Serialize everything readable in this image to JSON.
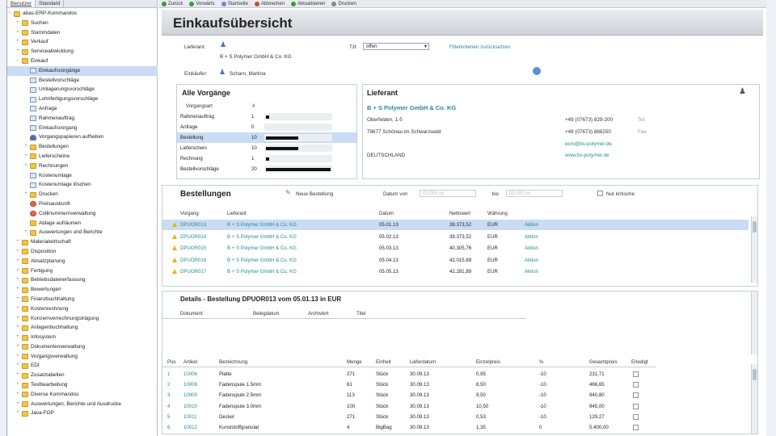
{
  "sidebar": {
    "tabs": [
      "Benutzer",
      "Standard"
    ],
    "tree": [
      {
        "label": "abas-ERP-Kommandos",
        "lvl": 0,
        "exp": "−",
        "icon": "folder"
      },
      {
        "label": "Suchen",
        "lvl": 1,
        "exp": "+",
        "icon": "folder"
      },
      {
        "label": "Stammdaten",
        "lvl": 1,
        "exp": "+",
        "icon": "folder"
      },
      {
        "label": "Verkauf",
        "lvl": 1,
        "exp": "+",
        "icon": "folder"
      },
      {
        "label": "Serviceabwicklung",
        "lvl": 1,
        "exp": "+",
        "icon": "folder"
      },
      {
        "label": "Einkauf",
        "lvl": 1,
        "exp": "−",
        "icon": "folder"
      },
      {
        "label": "Einkaufsvorgänge",
        "lvl": 2,
        "exp": "",
        "icon": "doc",
        "sel": true
      },
      {
        "label": "Bestellvorschläge",
        "lvl": 2,
        "exp": "",
        "icon": "doc"
      },
      {
        "label": "Umlagerungsvorschläge",
        "lvl": 2,
        "exp": "",
        "icon": "doc"
      },
      {
        "label": "Lohnfertigungsvorschläge",
        "lvl": 2,
        "exp": "",
        "icon": "doc"
      },
      {
        "label": "Anfrage",
        "lvl": 2,
        "exp": "",
        "icon": "doc"
      },
      {
        "label": "Rahmenauftrag",
        "lvl": 2,
        "exp": "",
        "icon": "doc"
      },
      {
        "label": "Einkaufsvorgang",
        "lvl": 2,
        "exp": "",
        "icon": "doc"
      },
      {
        "label": "Vorgangspapieren aufheben",
        "lvl": 2,
        "exp": "",
        "icon": "user"
      },
      {
        "label": "Bestellungen",
        "lvl": 2,
        "exp": "+",
        "icon": "folder"
      },
      {
        "label": "Lieferscheine",
        "lvl": 2,
        "exp": "+",
        "icon": "folder"
      },
      {
        "label": "Rechnungen",
        "lvl": 2,
        "exp": "+",
        "icon": "folder"
      },
      {
        "label": "Kostenumlage",
        "lvl": 2,
        "exp": "",
        "icon": "doc"
      },
      {
        "label": "Kostenumlage löschen",
        "lvl": 2,
        "exp": "",
        "icon": "doc"
      },
      {
        "label": "Drucken",
        "lvl": 2,
        "exp": "+",
        "icon": "folder"
      },
      {
        "label": "Preisauskunft",
        "lvl": 2,
        "exp": "",
        "icon": "red"
      },
      {
        "label": "Collinummernverwaltung",
        "lvl": 2,
        "exp": "",
        "icon": "red"
      },
      {
        "label": "Ablage aufräumen",
        "lvl": 2,
        "exp": "",
        "icon": "folder"
      },
      {
        "label": "Auswertungen und Berichte",
        "lvl": 2,
        "exp": "+",
        "icon": "folder"
      },
      {
        "label": "Materialwirtschaft",
        "lvl": 1,
        "exp": "+",
        "icon": "folder"
      },
      {
        "label": "Disposition",
        "lvl": 1,
        "exp": "+",
        "icon": "folder"
      },
      {
        "label": "Absatzplanung",
        "lvl": 1,
        "exp": "+",
        "icon": "folder"
      },
      {
        "label": "Fertigung",
        "lvl": 1,
        "exp": "+",
        "icon": "folder"
      },
      {
        "label": "Betriebsdatenerfassung",
        "lvl": 1,
        "exp": "+",
        "icon": "folder"
      },
      {
        "label": "Bewertungen",
        "lvl": 1,
        "exp": "+",
        "icon": "folder"
      },
      {
        "label": "Finanzbuchhaltung",
        "lvl": 1,
        "exp": "+",
        "icon": "folder"
      },
      {
        "label": "Kostenrechnung",
        "lvl": 1,
        "exp": "+",
        "icon": "folder"
      },
      {
        "label": "Konzernverrechnungsträgung",
        "lvl": 1,
        "exp": "+",
        "icon": "folder"
      },
      {
        "label": "Anlagenbuchhaltung",
        "lvl": 1,
        "exp": "+",
        "icon": "folder"
      },
      {
        "label": "Infosystem",
        "lvl": 1,
        "exp": "+",
        "icon": "folder"
      },
      {
        "label": "Dokumentenverwaltung",
        "lvl": 1,
        "exp": "+",
        "icon": "folder"
      },
      {
        "label": "Vorgangsverwaltung",
        "lvl": 1,
        "exp": "+",
        "icon": "folder"
      },
      {
        "label": "EDI",
        "lvl": 1,
        "exp": "+",
        "icon": "folder"
      },
      {
        "label": "Zusatztabellen",
        "lvl": 1,
        "exp": "+",
        "icon": "folder"
      },
      {
        "label": "Testbearbeitung",
        "lvl": 1,
        "exp": "+",
        "icon": "folder"
      },
      {
        "label": "Diverse Kommandos",
        "lvl": 1,
        "exp": "+",
        "icon": "folder"
      },
      {
        "label": "Auswertungen, Berichte und Ausdrucke",
        "lvl": 1,
        "exp": "+",
        "icon": "folder"
      },
      {
        "label": "Java-FOP",
        "lvl": 1,
        "exp": "+",
        "icon": "folder"
      }
    ]
  },
  "toolbar": {
    "back": "Zurück",
    "forward": "Vorwärts",
    "start": "Startseite",
    "cancel": "Abbrechen",
    "refresh": "Aktualisieren",
    "print": "Drucken"
  },
  "header": {
    "title": "Einkaufsübersicht",
    "supplier_label": "Lieferant:",
    "supplier_name": "B + S Polymer GmbH & Co. KG",
    "tyd_label": "Tzt",
    "tyd_value": "offen",
    "filter_reset": "Filterkriterien zurücksetzen",
    "buyer_label": "Einkäufer:",
    "buyer_name": "Scharn, Martina"
  },
  "vorgaenge": {
    "title": "Alle Vorgänge",
    "col1": "Vorgangsart",
    "col2": "#",
    "rows": [
      {
        "name": "Rahmenauftrag",
        "count": 1
      },
      {
        "name": "Anfrage",
        "count": 0
      },
      {
        "name": "Bestellung",
        "count": 10
      },
      {
        "name": "Lieferschein",
        "count": 10
      },
      {
        "name": "Rechnung",
        "count": 1
      },
      {
        "name": "Bestellvorschläge",
        "count": 20
      }
    ]
  },
  "lieferant": {
    "title": "Lieferant",
    "name": "B + S Polymer GmbH & Co. KG",
    "street": "Oberfelden, 1-5",
    "city": "79677 Schönau im Schwarzwald",
    "country": "DEUTSCHLAND",
    "phone": "+49 (07673) 829-200",
    "phone_tag": "Tel.",
    "fax": "+49 (07673) 888250",
    "fax_tag": "Fax",
    "email": "ecm@bs-polymer.de",
    "web": "www.bs-polymer.de"
  },
  "bestellungen": {
    "title": "Bestellungen",
    "new_order": "Neue Bestellung",
    "date_from_label": "Datum von",
    "date_from": "03.000.xx",
    "date_to_label": "bis",
    "date_to": "03.000.xx",
    "critical_label": "Nur kritische",
    "headers": [
      "Vorgang",
      "Lieferant",
      "Datum",
      "Nettowert",
      "Währung",
      ""
    ],
    "rows": [
      {
        "id": "DPUOR013",
        "supplier": "B + S Polymer GmbH & Co. KG",
        "date": "05.01.13",
        "net": "39.373,52",
        "cur": "EUR",
        "action": "Aktion"
      },
      {
        "id": "DPUOR014",
        "supplier": "B + S Polymer GmbH & Co. KG",
        "date": "05.02.13",
        "net": "39.373,52",
        "cur": "EUR",
        "action": "Aktion"
      },
      {
        "id": "DPUOR015",
        "supplier": "B + S Polymer GmbH & Co. KG",
        "date": "05.03.13",
        "net": "40.305,76",
        "cur": "EUR",
        "action": "Aktion"
      },
      {
        "id": "DPUOR016",
        "supplier": "B + S Polymer GmbH & Co. KG",
        "date": "05.04.13",
        "net": "42.015,69",
        "cur": "EUR",
        "action": "Aktion"
      },
      {
        "id": "DPUOR017",
        "supplier": "B + S Polymer GmbH & Co. KG",
        "date": "05.05.13",
        "net": "42.281,89",
        "cur": "EUR",
        "action": "Aktion"
      }
    ]
  },
  "details": {
    "title": "Details - Bestellung DPUOR013 vom 05.01.13 in EUR",
    "doc_headers": [
      "Dokument",
      "Belegdatum",
      "Archiviert",
      "Titel"
    ],
    "headers": [
      "Pos",
      "Artikel",
      "Bezeichnung",
      "Menge",
      "Einheit",
      "Lieferdatum",
      "Einzelpreis",
      "%",
      "Gesamtpreis",
      "Erledigt"
    ],
    "rows": [
      {
        "pos": "1",
        "art": "10006",
        "desc": "Platte",
        "qty": "271",
        "unit": "Stück",
        "date": "30.09.13",
        "price": "0,95",
        "pct": "-10",
        "total": "231,71"
      },
      {
        "pos": "2",
        "art": "10008",
        "desc": "Fadenspule 1.5mm",
        "qty": "61",
        "unit": "Stück",
        "date": "30.09.13",
        "price": "8,50",
        "pct": "-10",
        "total": "466,65"
      },
      {
        "pos": "3",
        "art": "10009",
        "desc": "Fadenspule 2.5mm",
        "qty": "113",
        "unit": "Stück",
        "date": "30.09.13",
        "price": "9,50",
        "pct": "-10",
        "total": "940,80"
      },
      {
        "pos": "4",
        "art": "10010",
        "desc": "Fadenspule 3.0mm",
        "qty": "100",
        "unit": "Stück",
        "date": "30.09.13",
        "price": "10,50",
        "pct": "-10",
        "total": "945,00"
      },
      {
        "pos": "5",
        "art": "10011",
        "desc": "Deckel",
        "qty": "271",
        "unit": "Stück",
        "date": "30.09.13",
        "price": "0,53",
        "pct": "-10",
        "total": "129,27"
      },
      {
        "pos": "6",
        "art": "10012",
        "desc": "Kunststoffgranulat",
        "qty": "4",
        "unit": "BigBag",
        "date": "30.09.13",
        "price": "1,35",
        "pct": "0",
        "total": "5.400,00"
      }
    ]
  },
  "colors": {
    "accent_teal": "#2a8a8a",
    "selection": "#c9dcf3"
  }
}
